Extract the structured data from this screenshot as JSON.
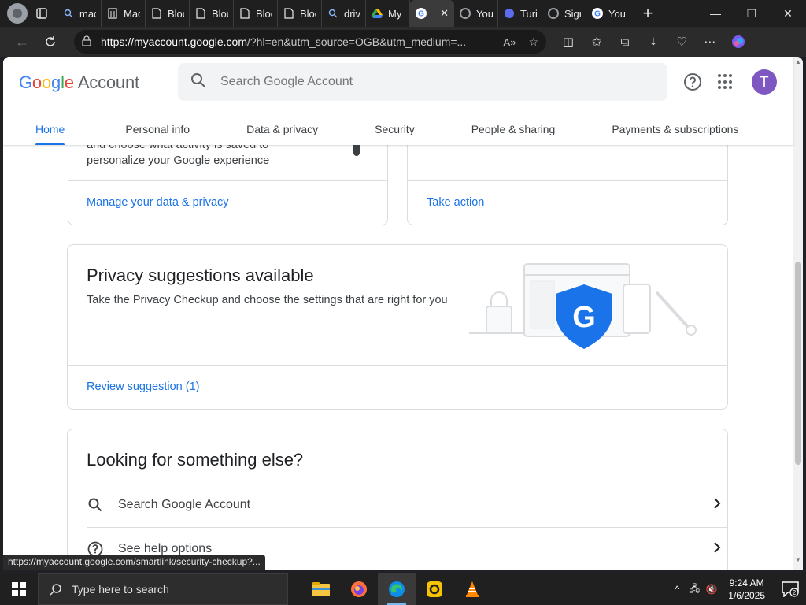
{
  "browser": {
    "tabs": [
      {
        "label": "mac",
        "icon": "search-icon"
      },
      {
        "label": "Mac",
        "icon": "document-icon"
      },
      {
        "label": "Bloc",
        "icon": "document-icon"
      },
      {
        "label": "Bloc",
        "icon": "document-icon"
      },
      {
        "label": "Bloc",
        "icon": "document-icon"
      },
      {
        "label": "Bloc",
        "icon": "document-icon"
      },
      {
        "label": "driv",
        "icon": "search-icon"
      },
      {
        "label": "My",
        "icon": "google-drive-icon"
      },
      {
        "label": "",
        "icon": "google-icon",
        "active": true
      },
      {
        "label": "You",
        "icon": "google-icon"
      },
      {
        "label": "Turi",
        "icon": "extension-icon"
      },
      {
        "label": "Sign",
        "icon": "google-icon"
      },
      {
        "label": "You",
        "icon": "google-icon"
      }
    ],
    "close_tab": "✕",
    "new_tab": "+",
    "url_host": "https://myaccount.google.com",
    "url_rest": "/?hl=en&utm_source=OGB&utm_medium=...",
    "read_aloud": "A»"
  },
  "header": {
    "logo_parts": [
      "G",
      "o",
      "o",
      "g",
      "l",
      "e"
    ],
    "logo_account": "Account",
    "search_placeholder": "Search Google Account",
    "avatar_letter": "T"
  },
  "nav": {
    "tabs": [
      "Home",
      "Personal info",
      "Data & privacy",
      "Security",
      "People & sharing",
      "Payments & subscriptions"
    ],
    "active": "Home"
  },
  "cards": {
    "data_privacy": {
      "text_line1": "and choose what activity is saved to",
      "text_line2": "personalize your Google experience",
      "link": "Manage your data & privacy"
    },
    "security": {
      "link": "Take action"
    },
    "privacy_suggestions": {
      "title": "Privacy suggestions available",
      "description": "Take the Privacy Checkup and choose the settings that are right for you",
      "link": "Review suggestion (1)",
      "shield_letter": "G"
    },
    "looking": {
      "title": "Looking for something else?",
      "rows": [
        {
          "label": "Search Google Account",
          "icon": "search-icon"
        },
        {
          "label": "See help options",
          "icon": "help-icon"
        }
      ]
    }
  },
  "status_url": "https://myaccount.google.com/smartlink/security-checkup?...",
  "taskbar": {
    "search_placeholder": "Type here to search",
    "time": "9:24 AM",
    "date": "1/6/2025",
    "notifications": "2"
  },
  "colors": {
    "accent": "#1a73e8",
    "avatar": "#7e57c2",
    "shield": "#1a73e8"
  }
}
